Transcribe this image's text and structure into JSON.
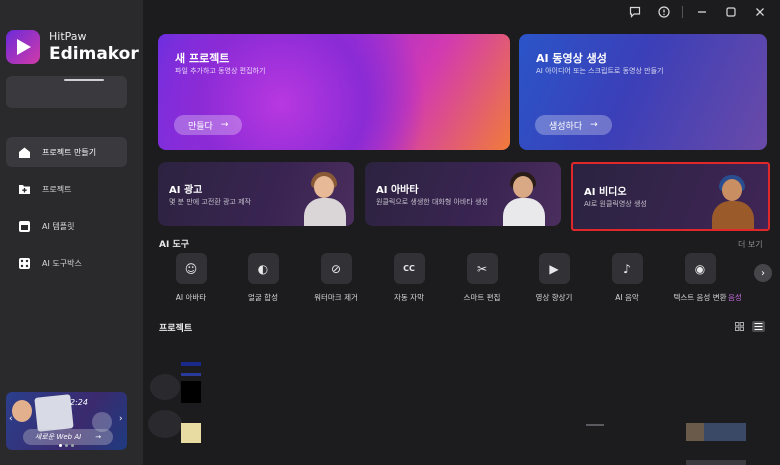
{
  "brand": {
    "sub": "HitPaw",
    "main": "Edimakor"
  },
  "nav": [
    {
      "label": "프로젝트 만들기",
      "icon": "home-icon",
      "active": true
    },
    {
      "label": "프로젝트",
      "icon": "folder-icon",
      "active": false
    },
    {
      "label": "AI 템플릿",
      "icon": "template-icon",
      "active": false
    },
    {
      "label": "AI 도구박스",
      "icon": "toolbox-icon",
      "active": false
    }
  ],
  "promo": {
    "time": "2:24",
    "button": "새로운 Web AI",
    "arrow": "→"
  },
  "titlebar": {
    "icons": [
      "feedback-icon",
      "info-icon",
      "minimize-icon",
      "maximize-icon",
      "close-icon"
    ]
  },
  "hero": [
    {
      "title": "새 프로젝트",
      "subtitle": "파일 추가하고 동영상 편집하기",
      "button": "만들다",
      "arrow": "→"
    },
    {
      "title": "AI 동영상 생성",
      "subtitle": "AI 아이디어 또는 스크립트로 동영상 만들기",
      "button": "생성하다",
      "arrow": "→"
    }
  ],
  "features": [
    {
      "title": "AI 광고",
      "subtitle": "몇 분 만에 고전환 광고 제작"
    },
    {
      "title": "AI 아바타",
      "subtitle": "원클릭으로 생생한 대화형 아바타 생성"
    },
    {
      "title": "AI 비디오",
      "subtitle": "AI로 원클릭영상 생성"
    }
  ],
  "ai_tools": {
    "heading": "AI 도구",
    "more": "더 보기",
    "items": [
      {
        "label": "AI 아바타",
        "icon": "avatar-icon",
        "glyph": "☺"
      },
      {
        "label": "얼굴 합성",
        "icon": "face-swap-icon",
        "glyph": "◐"
      },
      {
        "label": "워터마크 제거",
        "icon": "watermark-remove-icon",
        "glyph": "⊘"
      },
      {
        "label": "자동 자막",
        "icon": "subtitle-icon",
        "glyph": "CC"
      },
      {
        "label": "스마트 편집",
        "icon": "smart-cut-icon",
        "glyph": "✂"
      },
      {
        "label": "영상 향상기",
        "icon": "enhancer-icon",
        "glyph": "▶"
      },
      {
        "label": "AI 음악",
        "icon": "music-icon",
        "glyph": "♪"
      },
      {
        "label": "텍스트 음성 변환",
        "icon": "tts-icon",
        "glyph": "◉"
      },
      {
        "label": "음성",
        "icon": "voice-icon",
        "glyph": ""
      }
    ]
  },
  "projects": {
    "heading": "프로젝트"
  },
  "colors": {
    "accent": "#c26bdc",
    "highlight_border": "#e0282a"
  }
}
